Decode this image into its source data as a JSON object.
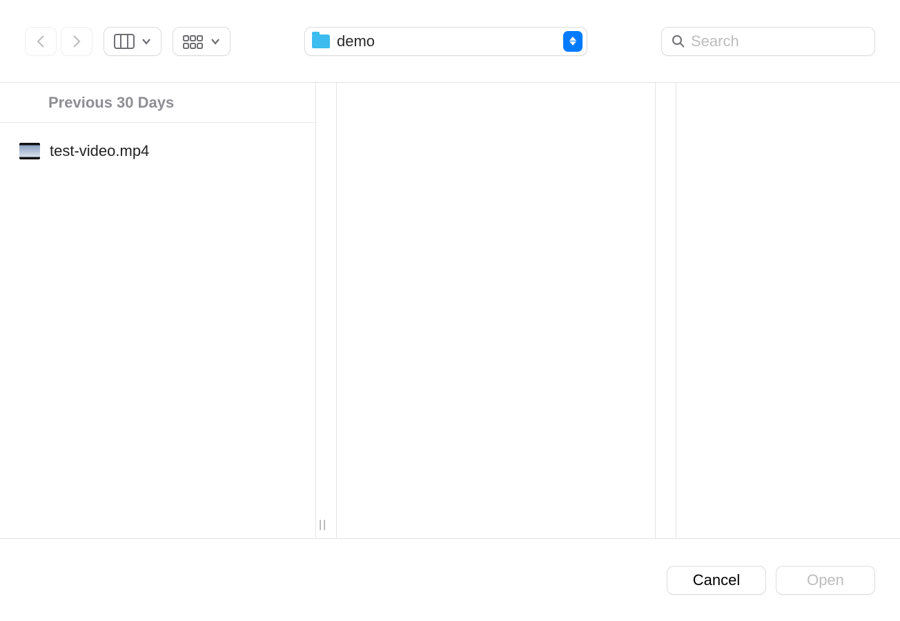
{
  "toolbar": {
    "location_name": "demo",
    "search_placeholder": "Search"
  },
  "list": {
    "section_label": "Previous 30 Days",
    "files": [
      {
        "name": "test-video.mp4"
      }
    ]
  },
  "footer": {
    "cancel_label": "Cancel",
    "open_label": "Open"
  }
}
